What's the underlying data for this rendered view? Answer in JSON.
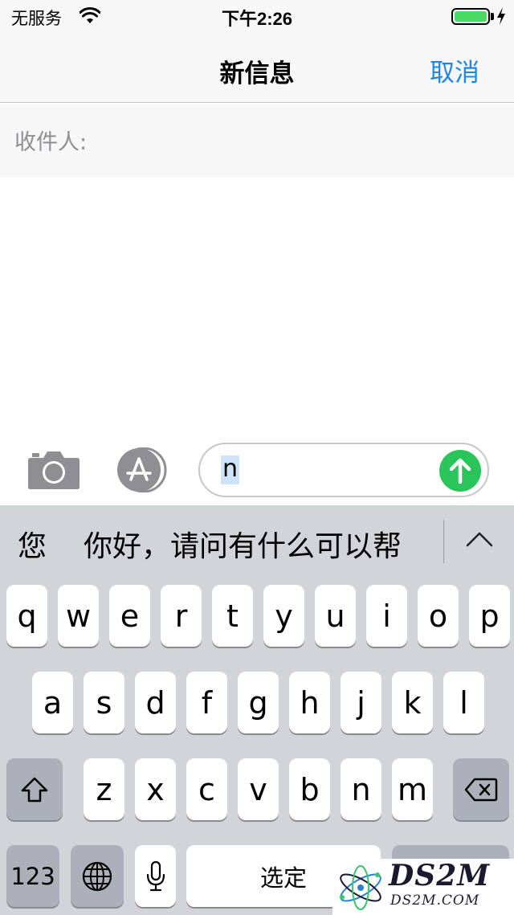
{
  "status_bar": {
    "carrier": "无服务",
    "time": "下午2:26",
    "wifi_icon": "wifi-icon",
    "battery_icon": "battery-icon",
    "charging_icon": "bolt-icon",
    "battery_color": "#4cd964"
  },
  "nav": {
    "title": "新信息",
    "cancel_label": "取消",
    "accent_color": "#1e87e6"
  },
  "recipient": {
    "label": "收件人:",
    "value": ""
  },
  "compose": {
    "text": "n",
    "camera_icon": "camera-icon",
    "appstore_icon": "app-store-icon",
    "send_icon": "send-arrow-icon",
    "send_color": "#29c45a"
  },
  "keyboard": {
    "candidates": [
      "您",
      "你好，请问有什么可以帮"
    ],
    "expand_icon": "chevron-up-icon",
    "row1": [
      "q",
      "w",
      "e",
      "r",
      "t",
      "y",
      "u",
      "i",
      "o",
      "p"
    ],
    "row2": [
      "a",
      "s",
      "d",
      "f",
      "g",
      "h",
      "j",
      "k",
      "l"
    ],
    "row3": [
      "z",
      "x",
      "c",
      "v",
      "b",
      "n",
      "m"
    ],
    "shift_icon": "shift-icon",
    "delete_icon": "delete-icon",
    "numbers_label": "123",
    "globe_icon": "globe-icon",
    "mic_icon": "microphone-icon",
    "space_label": "选定"
  },
  "watermark": {
    "main": "DS2M",
    "sub": "DS2M.COM"
  }
}
